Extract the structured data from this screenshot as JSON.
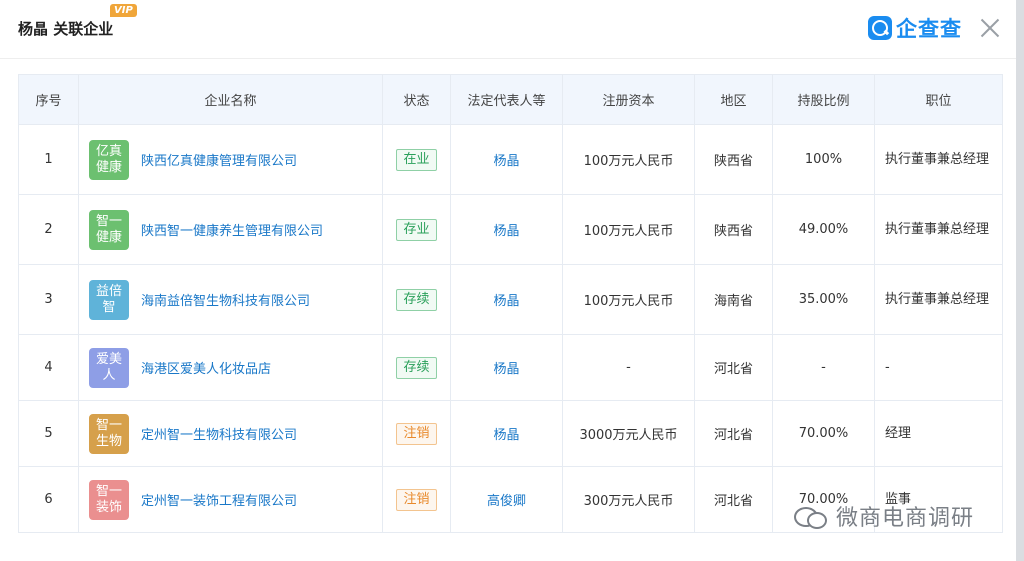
{
  "header": {
    "title": "杨晶 关联企业",
    "vip_badge": "VIP",
    "brand": "企查查"
  },
  "table": {
    "columns": [
      "序号",
      "企业名称",
      "状态",
      "法定代表人等",
      "注册资本",
      "地区",
      "持股比例",
      "职位"
    ],
    "rows": [
      {
        "index": "1",
        "logo": "亿真健康",
        "logo_color": "#6cc070",
        "name": "陕西亿真健康管理有限公司",
        "status": "在业",
        "status_type": "green",
        "rep": "杨晶",
        "capital": "100万元人民币",
        "region": "陕西省",
        "share": "100%",
        "position": "执行董事兼总经理"
      },
      {
        "index": "2",
        "logo": "智一健康",
        "logo_color": "#6cc070",
        "name": "陕西智一健康养生管理有限公司",
        "status": "存业",
        "status_type": "green",
        "rep": "杨晶",
        "capital": "100万元人民币",
        "region": "陕西省",
        "share": "49.00%",
        "position": "执行董事兼总经理"
      },
      {
        "index": "3",
        "logo": "益倍智",
        "logo_color": "#5fb3d9",
        "name": "海南益倍智生物科技有限公司",
        "status": "存续",
        "status_type": "green",
        "rep": "杨晶",
        "capital": "100万元人民币",
        "region": "海南省",
        "share": "35.00%",
        "position": "执行董事兼总经理"
      },
      {
        "index": "4",
        "logo": "爱美人",
        "logo_color": "#8e9ee6",
        "name": "海港区爱美人化妆品店",
        "status": "存续",
        "status_type": "green",
        "rep": "杨晶",
        "capital": "-",
        "region": "河北省",
        "share": "-",
        "position": "-"
      },
      {
        "index": "5",
        "logo": "智一生物",
        "logo_color": "#d6a04b",
        "name": "定州智一生物科技有限公司",
        "status": "注销",
        "status_type": "orange",
        "rep": "杨晶",
        "capital": "3000万元人民币",
        "region": "河北省",
        "share": "70.00%",
        "position": "经理"
      },
      {
        "index": "6",
        "logo": "智一装饰",
        "logo_color": "#ea8f8f",
        "name": "定州智一装饰工程有限公司",
        "status": "注销",
        "status_type": "orange",
        "rep": "高俊卿",
        "capital": "300万元人民币",
        "region": "河北省",
        "share": "70.00%",
        "position": "监事"
      }
    ]
  },
  "watermark": {
    "text": "微商电商调研",
    "icon": "wechat-icon"
  }
}
